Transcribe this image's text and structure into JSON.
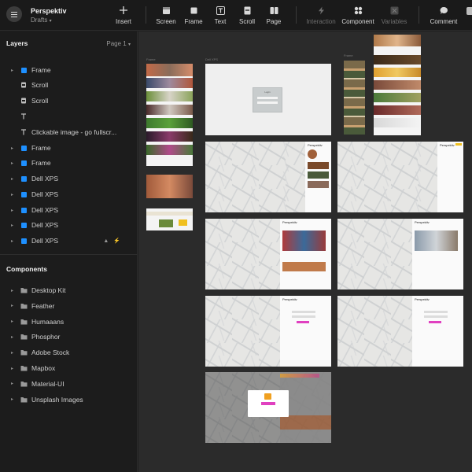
{
  "header": {
    "project_title": "Perspektiv",
    "project_subtitle": "Drafts",
    "tools": [
      {
        "label": "Insert",
        "icon": "plus-icon"
      },
      {
        "label": "Screen",
        "icon": "screen-icon"
      },
      {
        "label": "Frame",
        "icon": "frame-icon"
      },
      {
        "label": "Text",
        "icon": "text-icon"
      },
      {
        "label": "Scroll",
        "icon": "scroll-icon"
      },
      {
        "label": "Page",
        "icon": "page-icon"
      },
      {
        "label": "Interaction",
        "icon": "bolt-icon"
      },
      {
        "label": "Component",
        "icon": "component-icon"
      },
      {
        "label": "Variables",
        "icon": "variables-icon"
      },
      {
        "label": "Comment",
        "icon": "comment-icon"
      }
    ],
    "colors": {
      "accent": "#1e90ff",
      "canvas": "#2b2b2b",
      "panel": "#1c1c1c"
    }
  },
  "sidebar": {
    "layers_title": "Layers",
    "page_selector": "Page 1",
    "layers": [
      {
        "label": "Frame",
        "icon": "frame-layer-icon"
      },
      {
        "label": "Scroll",
        "icon": "scroll-layer-icon"
      },
      {
        "label": "Scroll",
        "icon": "scroll-layer-icon"
      },
      {
        "label": "",
        "icon": "text-layer-icon"
      },
      {
        "label": "Clickable image - go fullscr...",
        "icon": "text-layer-icon"
      },
      {
        "label": "Frame",
        "icon": "frame-layer-icon"
      },
      {
        "label": "Frame",
        "icon": "frame-layer-icon"
      },
      {
        "label": "Dell XPS",
        "icon": "frame-layer-icon"
      },
      {
        "label": "Dell XPS",
        "icon": "frame-layer-icon"
      },
      {
        "label": "Dell XPS",
        "icon": "frame-layer-icon"
      },
      {
        "label": "Dell XPS",
        "icon": "frame-layer-icon"
      },
      {
        "label": "Dell XPS",
        "icon": "frame-layer-icon"
      }
    ],
    "components_title": "Components",
    "components": [
      {
        "label": "Desktop Kit"
      },
      {
        "label": "Feather"
      },
      {
        "label": "Humaaans"
      },
      {
        "label": "Phosphor"
      },
      {
        "label": "Adobe Stock"
      },
      {
        "label": "Mapbox"
      },
      {
        "label": "Material-UI"
      },
      {
        "label": "Unsplash Images"
      }
    ]
  },
  "canvas": {
    "frame_labels": {
      "frame": "Frame",
      "dell": "Dell XPS"
    },
    "app_name": "Perspektiv",
    "login_title": "Login"
  }
}
